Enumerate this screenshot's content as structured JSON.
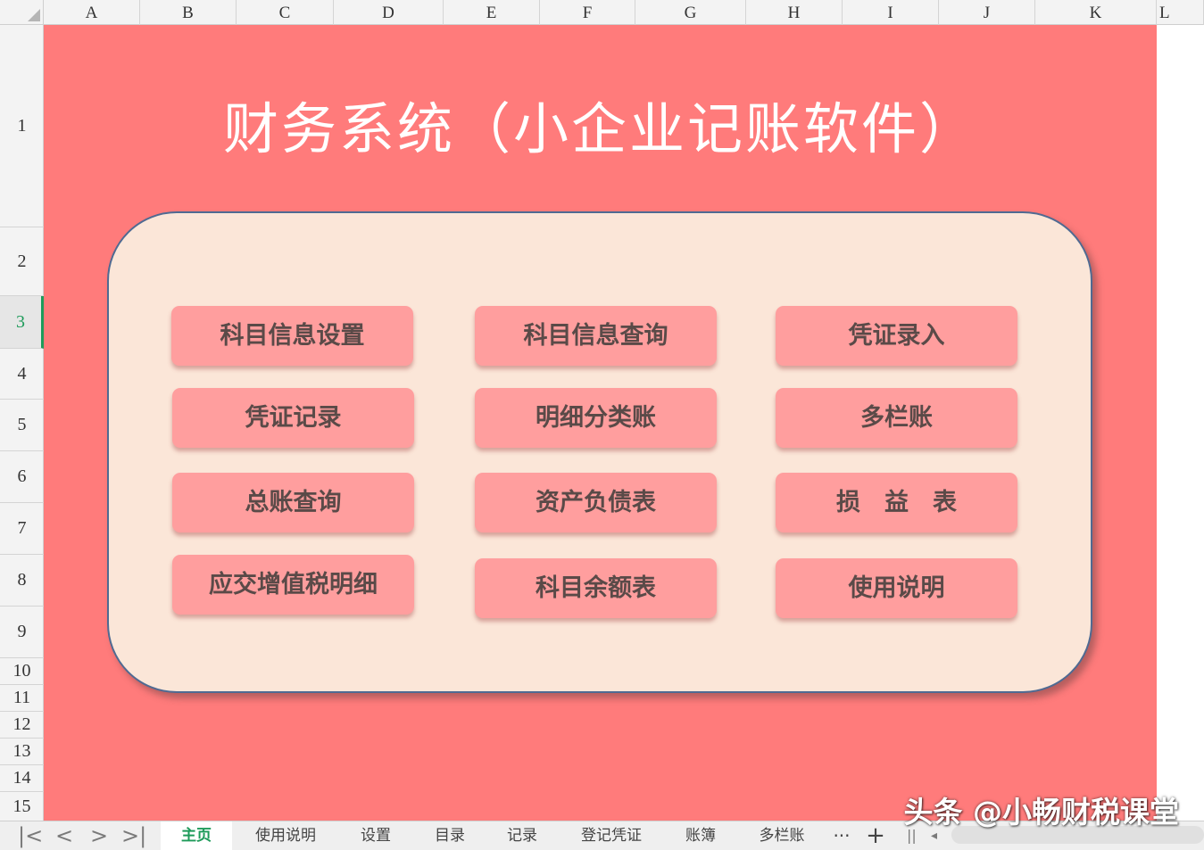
{
  "columns": [
    "A",
    "B",
    "C",
    "D",
    "E",
    "F",
    "G",
    "H",
    "I",
    "J",
    "K",
    "L"
  ],
  "rows": [
    "1",
    "2",
    "3",
    "4",
    "5",
    "6",
    "7",
    "8",
    "9",
    "10",
    "11",
    "12",
    "13",
    "14",
    "15"
  ],
  "selected_row": "3",
  "title": "财务系统（小企业记账软件）",
  "buttons": [
    {
      "id": "subject-info-setup",
      "label": "科目信息设置"
    },
    {
      "id": "subject-info-query",
      "label": "科目信息查询"
    },
    {
      "id": "voucher-entry",
      "label": "凭证录入"
    },
    {
      "id": "voucher-record",
      "label": "凭证记录"
    },
    {
      "id": "detail-ledger",
      "label": "明细分类账"
    },
    {
      "id": "multi-column-ledger",
      "label": "多栏账"
    },
    {
      "id": "general-ledger-query",
      "label": "总账查询"
    },
    {
      "id": "balance-sheet",
      "label": "资产负债表"
    },
    {
      "id": "income-statement",
      "label": "损　益　表"
    },
    {
      "id": "vat-detail",
      "label": "应交增值税明细"
    },
    {
      "id": "subject-balance",
      "label": "科目余额表"
    },
    {
      "id": "instructions",
      "label": "使用说明"
    }
  ],
  "tabs": [
    "主页",
    "使用说明",
    "设置",
    "目录",
    "记录",
    "登记凭证",
    "账簿",
    "多栏账"
  ],
  "active_tab": "主页",
  "tab_more": "···",
  "tab_add": "+",
  "nav": {
    "first": "|<",
    "prev": "<",
    "next": ">",
    "last": ">|"
  },
  "watermark": "头条 @小畅财税课堂",
  "colors": {
    "sheet_bg": "#ff7b7b",
    "panel_bg": "#fbe6d8",
    "button_bg": "#ff9e9e",
    "accent": "#1e9b5a"
  }
}
